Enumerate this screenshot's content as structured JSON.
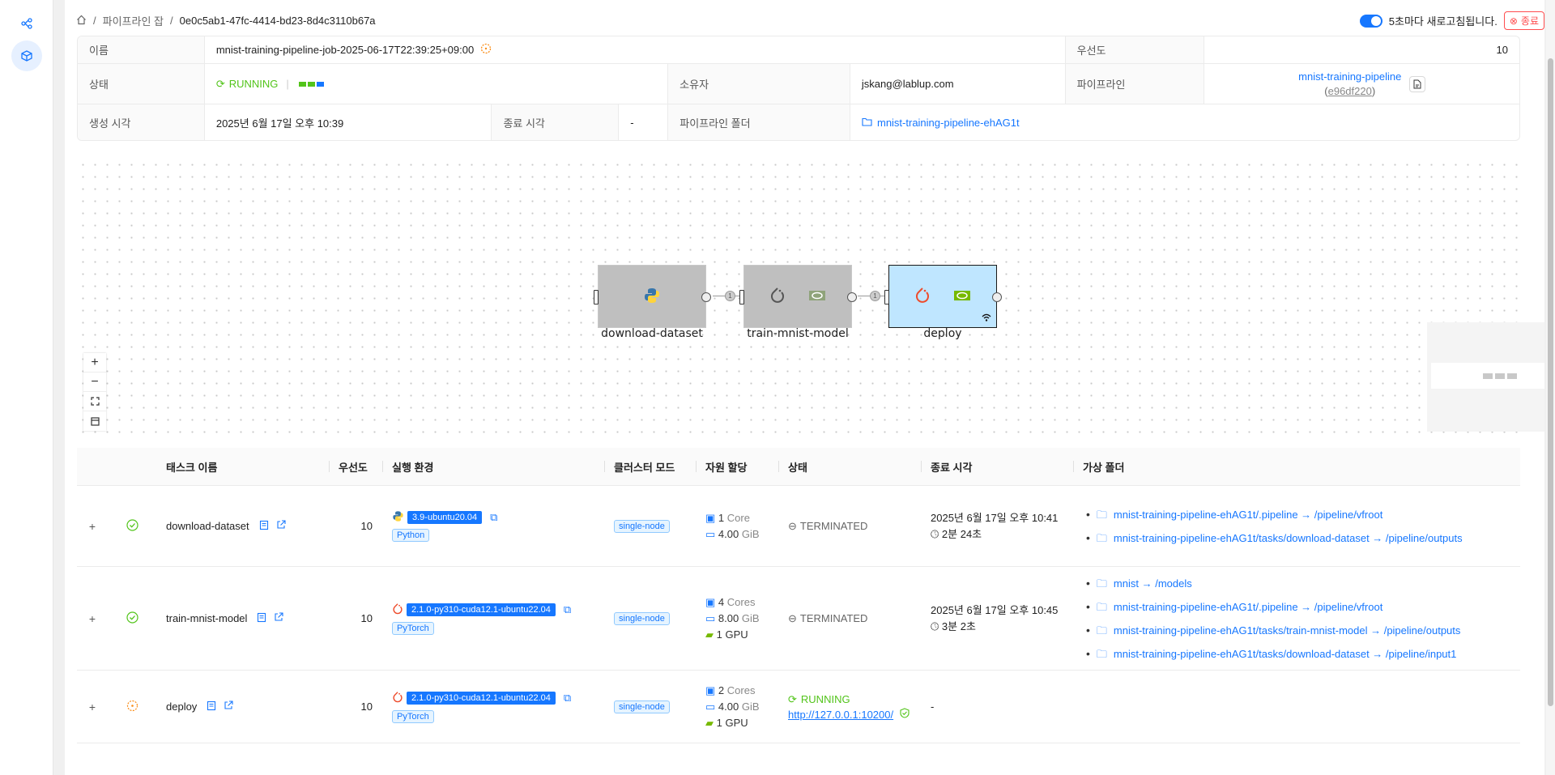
{
  "breadcrumb": {
    "parent": "파이프라인 잡",
    "current": "0e0c5ab1-47fc-4414-bd23-8d4c3110b67a"
  },
  "refresh": {
    "label": "5초마다 새로고침됩니다.",
    "end_label": "종료"
  },
  "details": {
    "name_label": "이름",
    "name_value": "mnist-training-pipeline-job-2025-06-17T22:39:25+09:00",
    "priority_label": "우선도",
    "priority_value": "10",
    "status_label": "상태",
    "status_value": "RUNNING",
    "owner_label": "소유자",
    "owner_value": "jskang@lablup.com",
    "pipeline_label": "파이프라인",
    "pipeline_value": "mnist-training-pipeline",
    "pipeline_commit": "e96df220",
    "created_label": "생성 시각",
    "created_value": "2025년 6월 17일 오후 10:39",
    "ended_label": "종료 시각",
    "ended_value": "-",
    "folder_label": "파이프라인 폴더",
    "folder_value": "mnist-training-pipeline-ehAG1t"
  },
  "graph": {
    "nodes": [
      {
        "name": "download-dataset"
      },
      {
        "name": "train-mnist-model"
      },
      {
        "name": "deploy"
      }
    ],
    "edge_badges": [
      "1",
      "1"
    ]
  },
  "table": {
    "headers": {
      "name": "태스크 이름",
      "priority": "우선도",
      "env": "실행 환경",
      "cluster": "클러스터 모드",
      "resources": "자원 할당",
      "status": "상태",
      "end_time": "종료 시각",
      "vfolders": "가상 폴더"
    },
    "rows": [
      {
        "name": "download-dataset",
        "priority": "10",
        "image": "3.9-ubuntu20.04",
        "lang": "Python",
        "cluster": "single-node",
        "cpu": "1",
        "cpu_unit": "Core",
        "mem": "4.00",
        "mem_unit": "GiB",
        "status": "TERMINATED",
        "end_time": "2025년 6월 17일 오후 10:41",
        "duration": "2분 24초",
        "vfolders": [
          "mnist-training-pipeline-ehAG1t/.pipeline → /pipeline/vfroot",
          "mnist-training-pipeline-ehAG1t/tasks/download-dataset → /pipeline/outputs"
        ]
      },
      {
        "name": "train-mnist-model",
        "priority": "10",
        "image": "2.1.0-py310-cuda12.1-ubuntu22.04",
        "lang": "PyTorch",
        "cluster": "single-node",
        "cpu": "4",
        "cpu_unit": "Cores",
        "mem": "8.00",
        "mem_unit": "GiB",
        "gpu": "1",
        "gpu_unit": "GPU",
        "status": "TERMINATED",
        "end_time": "2025년 6월 17일 오후 10:45",
        "duration": "3분 2초",
        "vfolders": [
          "mnist → /models",
          "mnist-training-pipeline-ehAG1t/.pipeline → /pipeline/vfroot",
          "mnist-training-pipeline-ehAG1t/tasks/train-mnist-model → /pipeline/outputs",
          "mnist-training-pipeline-ehAG1t/tasks/download-dataset → /pipeline/input1"
        ]
      },
      {
        "name": "deploy",
        "priority": "10",
        "image": "2.1.0-py310-cuda12.1-ubuntu22.04",
        "lang": "PyTorch",
        "cluster": "single-node",
        "cpu": "2",
        "cpu_unit": "Cores",
        "mem": "4.00",
        "mem_unit": "GiB",
        "gpu": "1",
        "gpu_unit": "GPU",
        "status": "RUNNING",
        "endpoint": "http://127.0.0.1:10200/",
        "end_time": "-"
      }
    ]
  },
  "colors": {
    "accent": "#1677ff",
    "success": "#52c41a",
    "running": "#fa8c16",
    "danger": "#ff4d4f",
    "node_selected": "#bfe6ff",
    "node_done": "#bfbfbf"
  }
}
